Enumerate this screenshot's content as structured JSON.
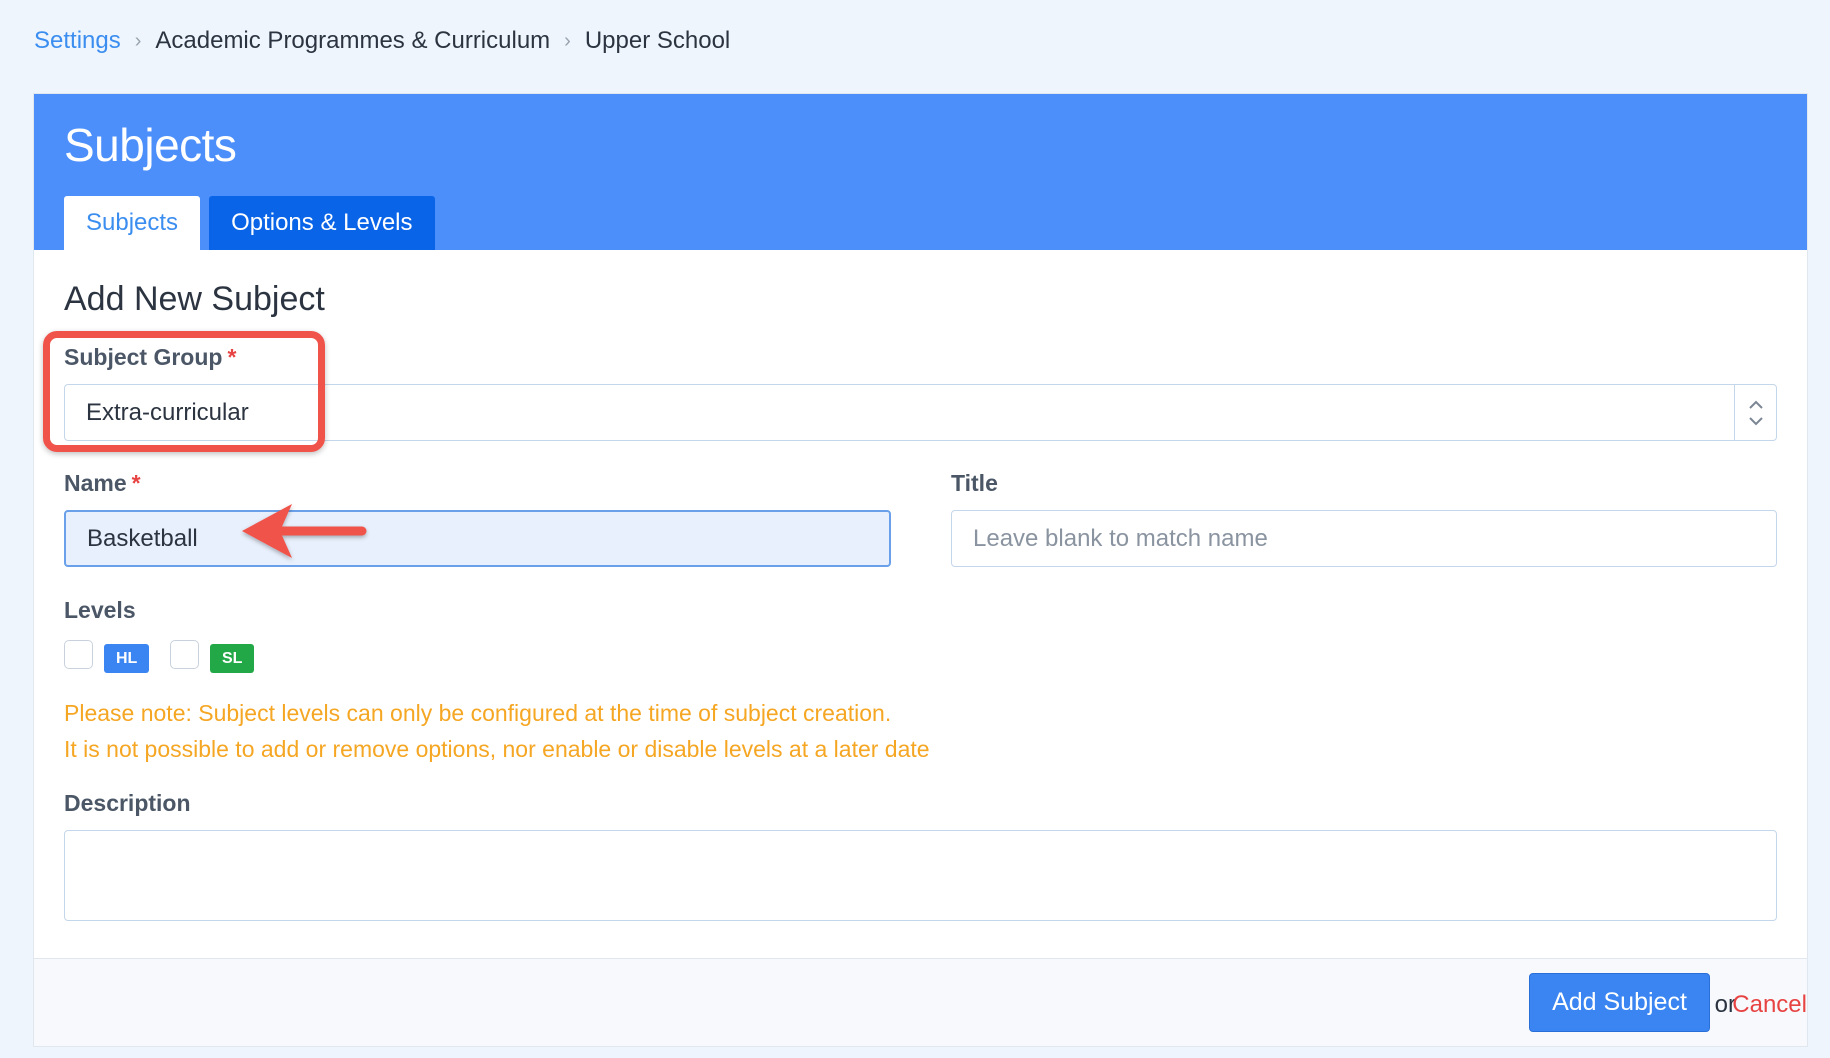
{
  "breadcrumb": {
    "items": [
      "Settings",
      "Academic Programmes & Curriculum",
      "Upper School"
    ],
    "separator": "›"
  },
  "header": {
    "title": "Subjects",
    "tabs": [
      {
        "label": "Subjects",
        "active": true
      },
      {
        "label": "Options & Levels",
        "active": false
      }
    ]
  },
  "form": {
    "section_title": "Add New Subject",
    "subject_group": {
      "label": "Subject Group",
      "required_mark": "*",
      "value": "Extra-curricular"
    },
    "name": {
      "label": "Name",
      "required_mark": "*",
      "value": "Basketball"
    },
    "title": {
      "label": "Title",
      "placeholder": "Leave blank to match name",
      "value": ""
    },
    "levels": {
      "label": "Levels",
      "items": [
        {
          "badge": "HL",
          "color": "#3a85f2",
          "checked": false
        },
        {
          "badge": "SL",
          "color": "#23a847",
          "checked": false
        }
      ]
    },
    "note_line1": "Please note: Subject levels can only be configured at the time of subject creation.",
    "note_line2": "It is not possible to add or remove options, nor enable or disable levels at a later date",
    "description": {
      "label": "Description",
      "value": ""
    }
  },
  "footer": {
    "submit_label": "Add Subject",
    "or_text": "or",
    "cancel_label": "Cancel"
  },
  "colors": {
    "header_bg": "#4c8ffb",
    "active_tab_text": "#3b8ef0",
    "inactive_tab_bg": "#0a64e8",
    "required": "#e84343",
    "note": "#f5a623",
    "annotation": "#f0534a"
  }
}
